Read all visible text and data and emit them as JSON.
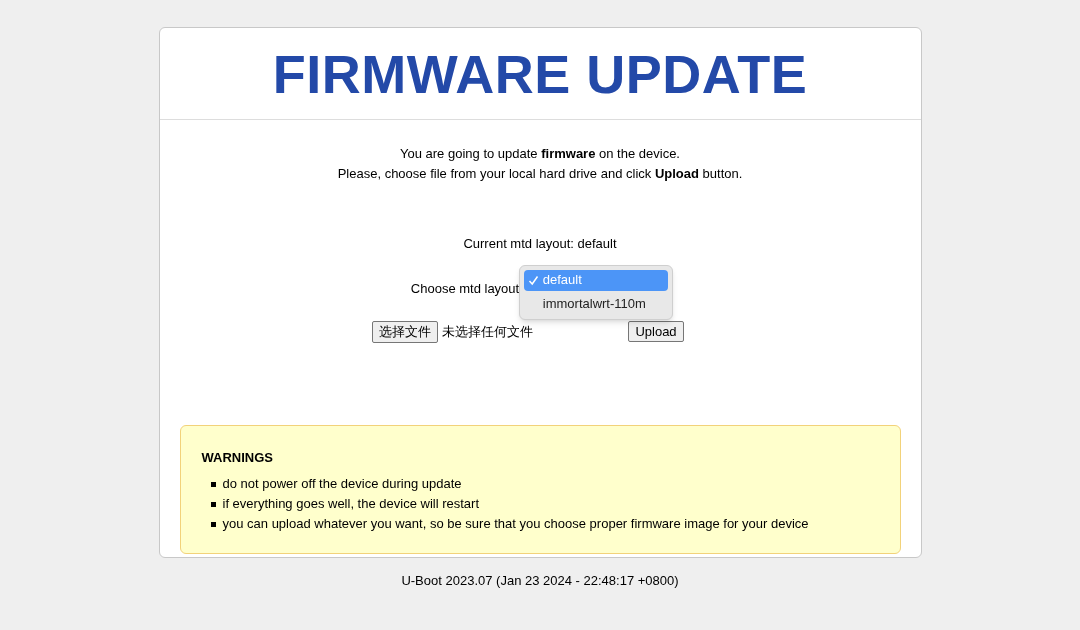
{
  "title": "FIRMWARE UPDATE",
  "intro": [
    "You are going to update **firmware** on the device.",
    "Please, choose file from your local hard drive and click **Upload** button."
  ],
  "current_layout": "Current mtd layout: default",
  "choose_label": "Choose mtd layout",
  "layout_options": [
    {
      "label": "default",
      "selected": true
    },
    {
      "label": "immortalwrt-110m",
      "selected": false
    }
  ],
  "file_button": "选择文件",
  "file_status": "未选择任何文件",
  "upload_button": "Upload",
  "warnings": {
    "title": "WARNINGS",
    "items": [
      "do not power off the device during update",
      "if everything goes well, the device will restart",
      "you can upload whatever you want, so be sure that you choose proper firmware image for your device"
    ]
  },
  "footer": "U-Boot 2023.07 (Jan 23 2024 - 22:48:17 +0800)"
}
